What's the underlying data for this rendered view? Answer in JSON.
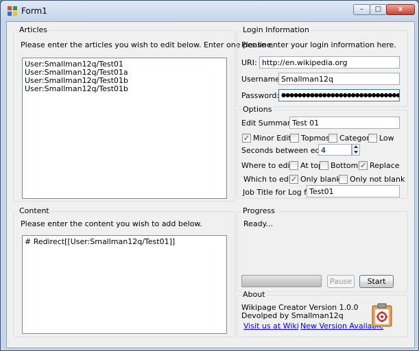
{
  "window": {
    "title": "Form1",
    "minimize_glyph": "–",
    "maximize_glyph": "□",
    "close_glyph": "x"
  },
  "articles": {
    "title": "Articles",
    "instructions": "Please enter the articles you wish to edit below.  Enter one per line.",
    "lines": [
      "User:Smallman12q/Test01",
      "User:Smallman12q/Test01a",
      "User:Smallman12q/Test01b",
      "User:Smallman12q/Test01b"
    ]
  },
  "content": {
    "title": "Content",
    "instructions": "Please enter the content you wish to add below.",
    "lines": [
      "# Redirect[[User:Smallman12q/Test01]]"
    ]
  },
  "login": {
    "title": "Login Information",
    "instructions": "Please enter your login information here.",
    "uri_label": "URI:",
    "uri_value": "http://en.wikipedia.org",
    "username_label": "Username:",
    "username_value": "Smallman12q",
    "password_label": "Password:",
    "password_value": "●●●●●●●●●●●●●●●●●●●●●●●●●●●●●"
  },
  "options": {
    "title": "Options",
    "edit_summary_label": "Edit Summary:",
    "edit_summary_value": "Test 01",
    "minor_edit_label": "Minor Edit",
    "minor_edit_checked": true,
    "topmost_label": "Topmost",
    "topmost_checked": false,
    "category_label": "Category",
    "category_checked": false,
    "low_label": "Low",
    "low_checked": false,
    "seconds_label": "Seconds between edits:",
    "seconds_value": "4",
    "where_label": "Where to edit:",
    "at_top_label": "At top",
    "at_top_checked": false,
    "bottom_label": "Bottom",
    "bottom_checked": false,
    "replace_label": "Replace",
    "replace_checked": true,
    "which_label": "Which to edit:",
    "only_blank_label": "Only blank",
    "only_blank_checked": true,
    "only_not_blank_label": "Only not blank",
    "only_not_blank_checked": false,
    "job_title_label": "Job Title for Log file:",
    "job_title_value": "Test01",
    "check_glyph": "✓"
  },
  "progress": {
    "title": "Progress",
    "status": "Ready...",
    "fraction": 0,
    "pause_label": "Pause",
    "start_label": "Start"
  },
  "about": {
    "title": "About",
    "version_text": "Wikipage Creator Version 1.0.0",
    "author_text": "Devolped by Smallman12q",
    "visit_link": "Visit us at Wikipedia",
    "new_version_link": "New Version Available"
  },
  "colors": {
    "title_bar": "#c5d5ea",
    "client_bg": "#f0f0f0",
    "link": "#0000ee",
    "group_border": "#d5dfe5"
  }
}
